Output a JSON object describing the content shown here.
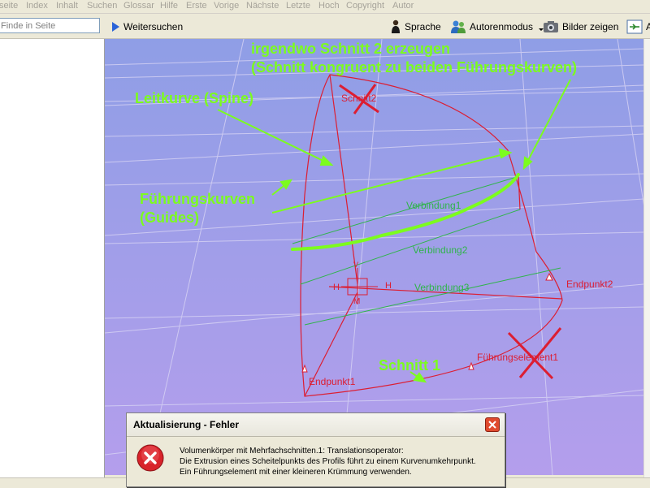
{
  "menu": [
    "seite",
    "Index",
    "Inhalt",
    "Suchen",
    "Glossar",
    "Hilfe",
    "Erste",
    "Vorige",
    "Nächste",
    "Letzte",
    "Hoch",
    "Copyright",
    "Autor"
  ],
  "search": {
    "placeholder": "Finde in Seite"
  },
  "toolbar": {
    "weitersuchen": "Weitersuchen",
    "sprache": "Sprache",
    "autorenmodus": "Autorenmodus",
    "bilder": "Bilder zeigen",
    "extra": "A"
  },
  "colors": {
    "green": "#7cfc1e",
    "red": "#dc1e32",
    "grid": "#d8d4f4",
    "sky_top": "#8f9ee6",
    "sky_bottom": "#b49eec"
  },
  "annotations": {
    "schnitt2_line1": "irgendwo Schnitt 2 erzeugen",
    "schnitt2_line2": "(Schnitt kongruent zu beiden Führungskurven)",
    "leitkurve": "Leitkurve (Spine)",
    "fuehrung_line1": "Führungskurven",
    "fuehrung_line2": "(Guides)",
    "schnitt1": "Schnitt 1"
  },
  "labels": {
    "schnitt2": "Schnitt2",
    "verbindung1": "Verbindung1",
    "verbindung2": "Verbindung2",
    "verbindung3": "Verbindung3",
    "endpunkt1": "Endpunkt1",
    "endpunkt2": "Endpunkt2",
    "fuehrungselement1": "Führungselement1",
    "h_left": "H",
    "h_right": "H",
    "v": "V",
    "m": "M"
  },
  "dialog": {
    "title": "Aktualisierung - Fehler",
    "line1": "Volumenkörper mit Mehrfachschnitten.1: Translationsoperator:",
    "line2": "Die Extrusion eines Scheitelpunkts des Profils führt zu einem Kurvenumkehrpunkt.",
    "line3": "Ein Führungselement mit einer kleineren Krümmung verwenden."
  }
}
